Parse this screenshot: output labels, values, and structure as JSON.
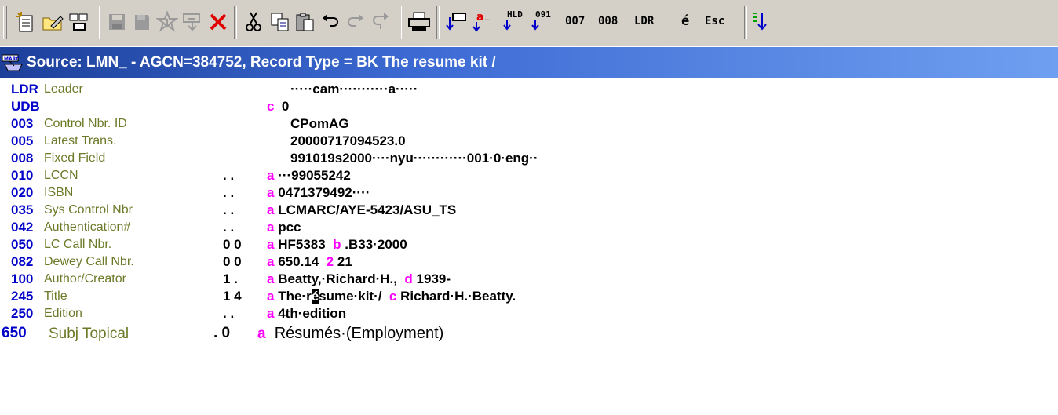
{
  "toolbar": {
    "icons": [
      "new-record-icon",
      "edit-record-icon",
      "merge-icon",
      "save-icon",
      "save-local-icon",
      "pending-icon",
      "export-icon",
      "delete-icon",
      "cut-icon",
      "copy-icon",
      "paste-icon",
      "undo-icon",
      "redo-icon",
      "redo-alt-icon",
      "print-icon",
      "add-field-icon",
      "add-subfield-icon",
      "hld-icon",
      "field-091-icon",
      "sort-icon"
    ],
    "hld": "HLD",
    "n091": "091",
    "b007": "007",
    "b008": "008",
    "bldr": "LDR",
    "bacute": "é",
    "besc": "Esc"
  },
  "title": {
    "text": "Source: LMN_ - AGCN=384752, Record Type = BK The resume kit /",
    "icon": "marc-record-icon"
  },
  "rows": [
    {
      "tag": "LDR",
      "label": "Leader",
      "ind": "",
      "sf1": "",
      "d1": "·····cam···········a·····",
      "sf2": "",
      "d2": ""
    },
    {
      "tag": "UDB",
      "label": "",
      "ind": "",
      "sf1": "c",
      "d1": "0",
      "sf2": "",
      "d2": ""
    },
    {
      "tag": "003",
      "label": "Control Nbr. ID",
      "ind": "",
      "sf1": "",
      "d1": "CPomAG",
      "sf2": "",
      "d2": ""
    },
    {
      "tag": "005",
      "label": "Latest Trans.",
      "ind": "",
      "sf1": "",
      "d1": "20000717094523.0",
      "sf2": "",
      "d2": ""
    },
    {
      "tag": "008",
      "label": "Fixed Field",
      "ind": "",
      "sf1": "",
      "d1": "991019s2000····nyu············001·0·eng··",
      "sf2": "",
      "d2": ""
    },
    {
      "tag": "010",
      "label": "LCCN",
      "ind": ". .",
      "sf1": "a",
      "d1": "···99055242",
      "sf2": "",
      "d2": ""
    },
    {
      "tag": "020",
      "label": "ISBN",
      "ind": ". .",
      "sf1": "a",
      "d1": "0471379492····",
      "sf2": "",
      "d2": ""
    },
    {
      "tag": "035",
      "label": "Sys Control Nbr",
      "ind": ". .",
      "sf1": "a",
      "d1": "LCMARC/AYE-5423/ASU_TS",
      "sf2": "",
      "d2": ""
    },
    {
      "tag": "042",
      "label": "Authentication#",
      "ind": ". .",
      "sf1": "a",
      "d1": "pcc",
      "sf2": "",
      "d2": ""
    },
    {
      "tag": "050",
      "label": "LC Call Nbr.",
      "ind": "0 0",
      "sf1": "a",
      "d1": "HF5383",
      "sf2": "b",
      "d2": ".B33·2000"
    },
    {
      "tag": "082",
      "label": "Dewey Call Nbr.",
      "ind": "0 0",
      "sf1": "a",
      "d1": "650.14",
      "sf2": "2",
      "d2": "21"
    },
    {
      "tag": "100",
      "label": "Author/Creator",
      "ind": "1 .",
      "sf1": "a",
      "d1": "Beatty,·Richard·H.,",
      "sf2": "d",
      "d2": "1939-"
    },
    {
      "tag": "245",
      "label": "Title",
      "ind": "1 4",
      "sf1": "a",
      "d1pre": "The·r",
      "d1cur": "é",
      "d1post": "sume·kit·/",
      "sf2": "c",
      "d2": "Richard·H.·Beatty."
    },
    {
      "tag": "250",
      "label": "Edition",
      "ind": ". .",
      "sf1": "a",
      "d1": "4th·edition",
      "sf2": "",
      "d2": ""
    },
    {
      "tag": "650",
      "label": "Subj Topical",
      "ind": ". 0",
      "sf1": "a",
      "d1": "Résumés·(Employment)",
      "sf2": "",
      "d2": ""
    }
  ]
}
